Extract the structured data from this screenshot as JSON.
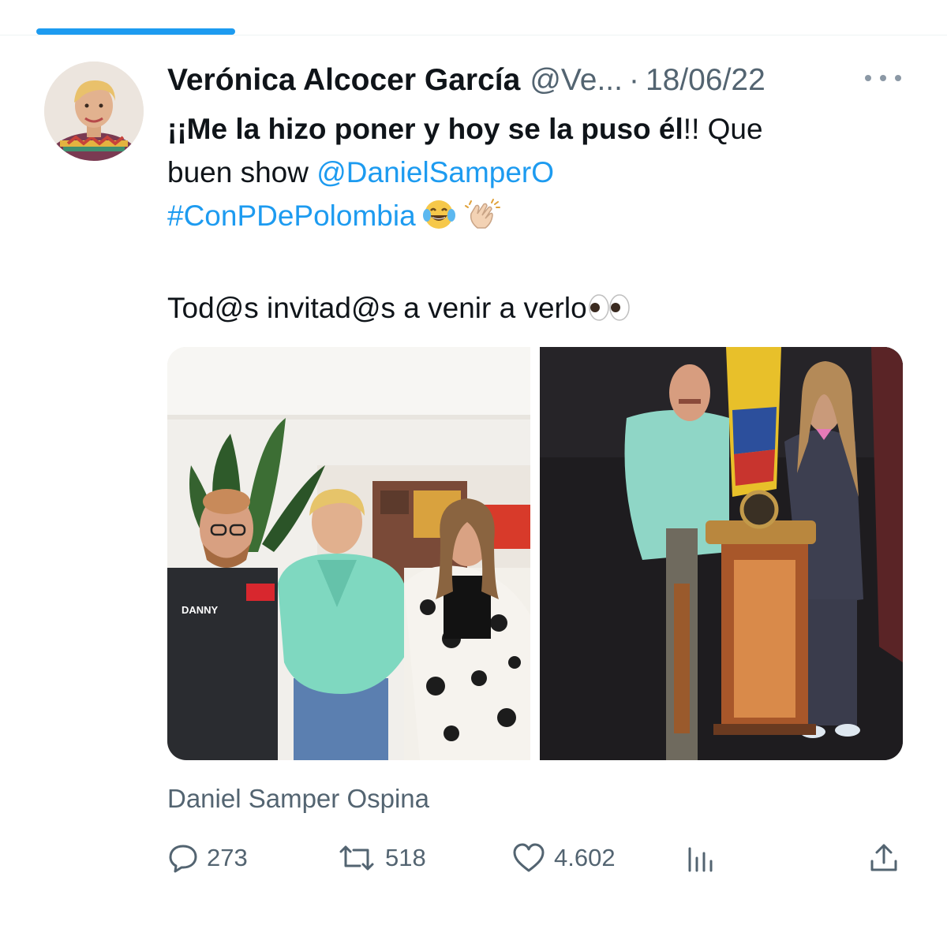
{
  "tweet": {
    "author_name": "Verónica Alcocer García",
    "handle": "@Ve...",
    "separator": "·",
    "date": "18/06/22",
    "text": {
      "bold_part": "¡¡Me la hizo poner y hoy se la puso él",
      "after_bold": "!! Que",
      "line2_prefix": "buen show ",
      "mention": "@DanielSamperO",
      "hashtag": "#ConPDePolombia",
      "line4": "Tod@s invitad@s a venir a verlo"
    },
    "media_caption": "Daniel Samper Ospina",
    "photo_left": {
      "jacket_name": "DANNY"
    },
    "stats": {
      "replies": "273",
      "retweets": "518",
      "likes": "4.602"
    }
  },
  "icons": {
    "more": "more-dots-icon",
    "reply": "reply-bubble-icon",
    "retweet": "retweet-icon",
    "like": "heart-icon",
    "views": "analytics-bars-icon",
    "share": "share-upload-icon",
    "emoji_laugh": "tears-of-joy-emoji",
    "emoji_clap": "clapping-hands-emoji",
    "emoji_eyes": "eyes-emoji"
  },
  "colors": {
    "link": "#1d9bf0",
    "secondary": "#536471",
    "text": "#0f1419"
  }
}
